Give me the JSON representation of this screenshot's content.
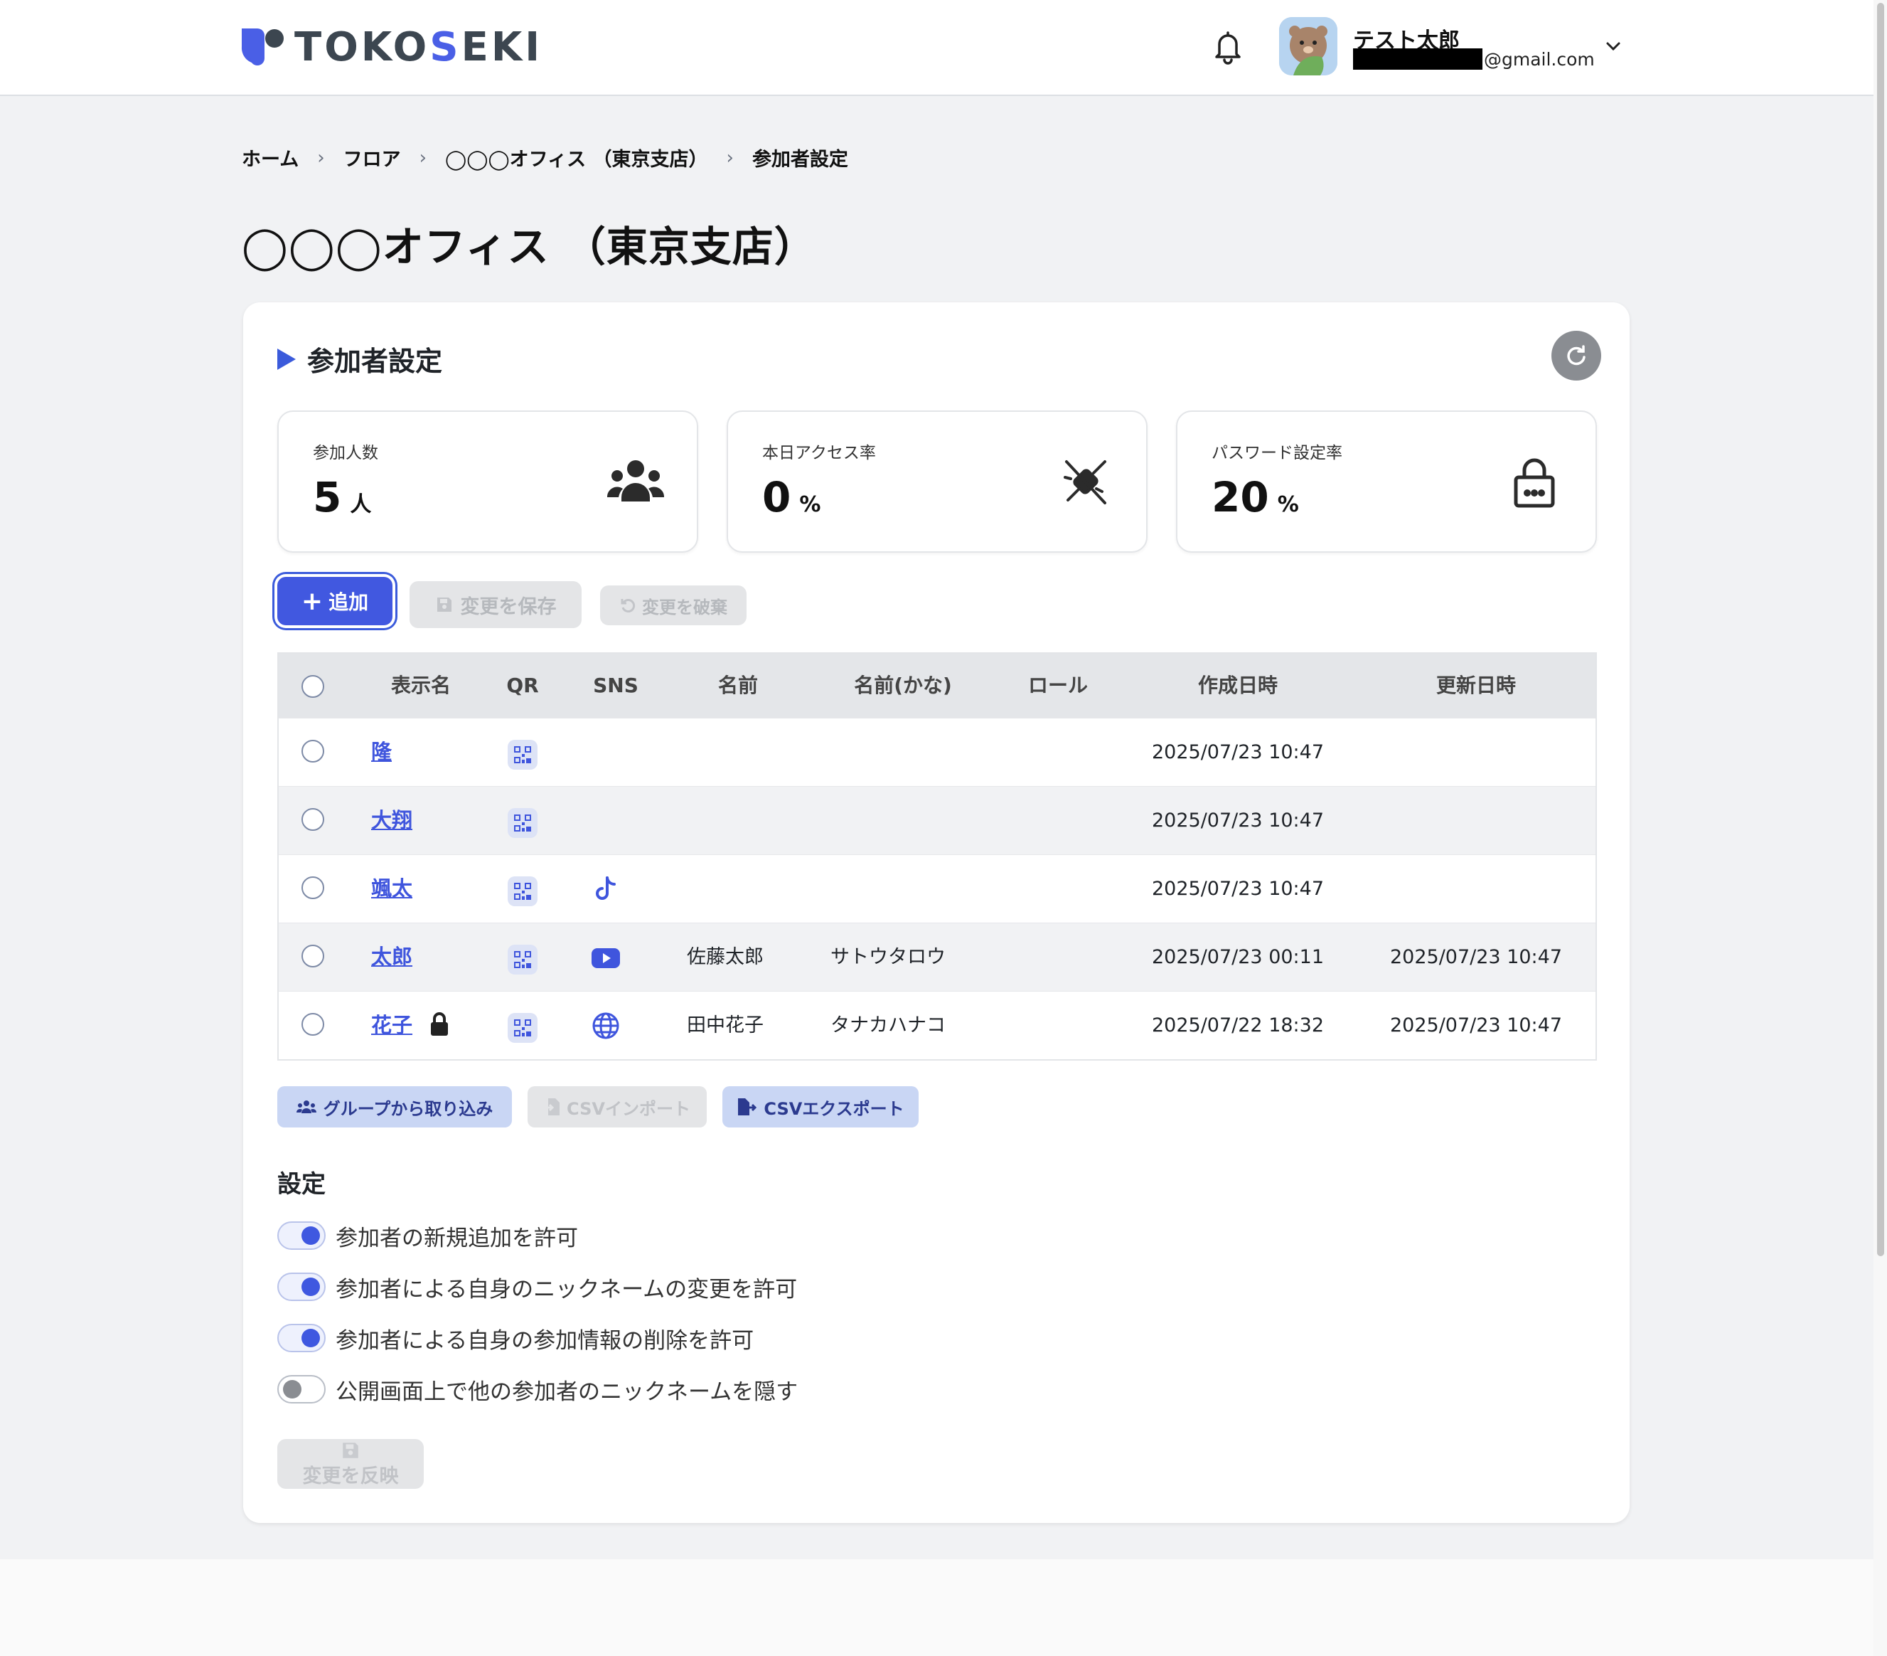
{
  "app": {
    "logo_text_a": "TOKO",
    "logo_text_b": "S",
    "logo_text_c": "EKI"
  },
  "user": {
    "name": "テスト太郎",
    "email_suffix": "@gmail.com"
  },
  "breadcrumb": [
    "ホーム",
    "フロア",
    "◯◯◯オフィス （東京支店）",
    "参加者設定"
  ],
  "page_title": "◯◯◯オフィス （東京支店）",
  "section": {
    "title": "参加者設定"
  },
  "stats": [
    {
      "label": "参加人数",
      "value": "5",
      "unit": "人",
      "icon": "users-icon"
    },
    {
      "label": "本日アクセス率",
      "value": "0",
      "unit": "%",
      "icon": "plug-icon"
    },
    {
      "label": "パスワード設定率",
      "value": "20",
      "unit": "%",
      "icon": "lock-icon"
    }
  ],
  "toolbar": {
    "add": "追加",
    "save": "変更を保存",
    "discard": "変更を破棄"
  },
  "table": {
    "headers": [
      "表示名",
      "QR",
      "SNS",
      "名前",
      "名前(かな)",
      "ロール",
      "作成日時",
      "更新日時"
    ],
    "rows": [
      {
        "display_name": "隆",
        "sns": "",
        "name": "",
        "kana": "",
        "role": "",
        "created": "2025/07/23 10:47",
        "updated": ""
      },
      {
        "display_name": "大翔",
        "sns": "",
        "name": "",
        "kana": "",
        "role": "",
        "created": "2025/07/23 10:47",
        "updated": ""
      },
      {
        "display_name": "颯太",
        "sns": "tiktok-icon",
        "name": "",
        "kana": "",
        "role": "",
        "created": "2025/07/23 10:47",
        "updated": ""
      },
      {
        "display_name": "太郎",
        "sns": "youtube-icon",
        "name": "佐藤太郎",
        "kana": "サトウタロウ",
        "role": "",
        "created": "2025/07/23 00:11",
        "updated": "2025/07/23 10:47"
      },
      {
        "display_name": "花子",
        "sns": "globe-icon",
        "locked": true,
        "name": "田中花子",
        "kana": "タナカハナコ",
        "role": "",
        "created": "2025/07/22 18:32",
        "updated": "2025/07/23 10:47"
      }
    ]
  },
  "bottom_buttons": {
    "group_import": "グループから取り込み",
    "csv_import": "CSVインポート",
    "csv_export": "CSVエクスポート"
  },
  "settings": {
    "title": "設定",
    "toggles": [
      {
        "label": "参加者の新規追加を許可",
        "on": true
      },
      {
        "label": "参加者による自身のニックネームの変更を許可",
        "on": true
      },
      {
        "label": "参加者による自身の参加情報の削除を許可",
        "on": true
      },
      {
        "label": "公開画面上で他の参加者のニックネームを隠す",
        "on": false
      }
    ],
    "apply": "変更を反映"
  },
  "colors": {
    "accent": "#4158e0",
    "background": "#f1f2f4"
  }
}
